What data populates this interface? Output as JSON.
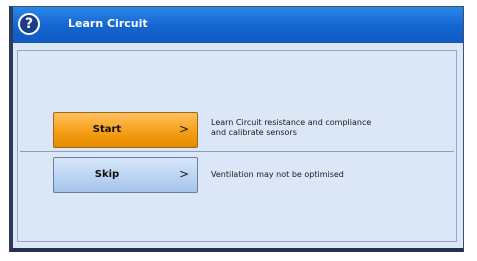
{
  "window": {
    "title": "Learn Circuit"
  },
  "options": [
    {
      "label": "Start",
      "description_line1": "Learn Circuit resistance and compliance",
      "description_line2": "and calibrate sensors"
    },
    {
      "label": "Skip",
      "description_line1": "Ventilation may not be optimised",
      "description_line2": ""
    }
  ],
  "chevron": ">",
  "help_glyph": "?",
  "colors": {
    "titlebar": "#1565cf",
    "start_button": "#f5a017",
    "skip_button": "#b8d2f2",
    "background": "#dbe6f6"
  }
}
